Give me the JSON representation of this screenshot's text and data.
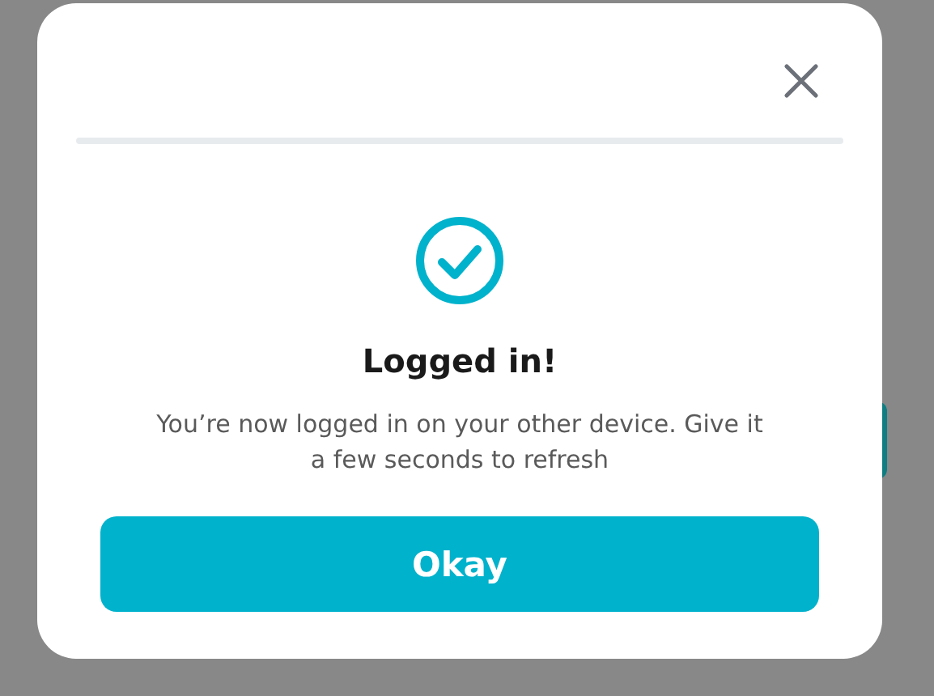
{
  "dialog": {
    "title": "Logged in!",
    "message": "You’re now logged in on your other device. Give it a few seconds to refresh",
    "button": "Okay"
  }
}
